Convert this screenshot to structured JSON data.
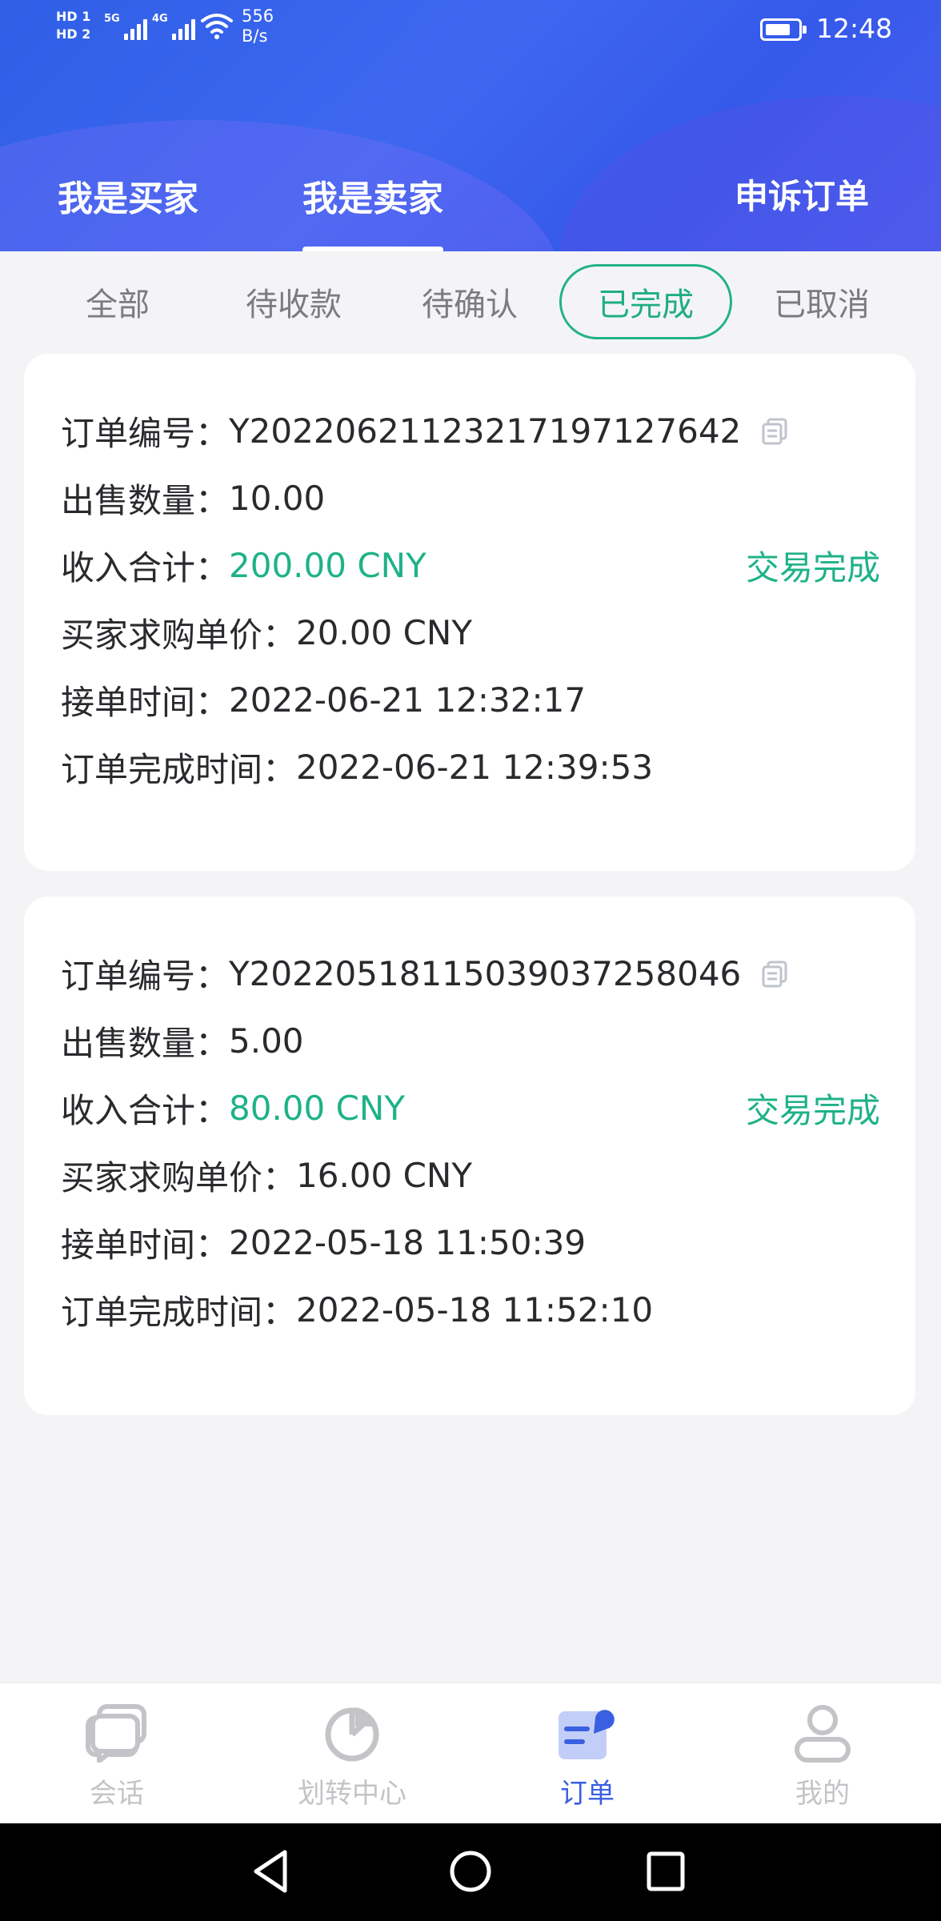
{
  "status_bar": {
    "sim1": "HD 1",
    "sim2": "HD 2",
    "net1": "5G",
    "net2": "4G",
    "speed_value": "556",
    "speed_unit": "B/s",
    "time": "12:48"
  },
  "header": {
    "tabs": [
      {
        "label": "我是买家"
      },
      {
        "label": "我是卖家"
      }
    ],
    "active_tab": 1,
    "appeal_label": "申诉订单"
  },
  "filters": [
    {
      "label": "全部"
    },
    {
      "label": "待收款"
    },
    {
      "label": "待确认"
    },
    {
      "label": "已完成"
    },
    {
      "label": "已取消"
    }
  ],
  "active_filter": 3,
  "orders": [
    {
      "order_no_label": "订单编号：",
      "order_no": "Y20220621123217197127642",
      "qty_label": "出售数量：",
      "qty": "10.00",
      "income_label": "收入合计：",
      "income": "200.00 CNY",
      "status": "交易完成",
      "price_label": "买家求购单价：",
      "price": "20.00 CNY",
      "accept_label": "接单时间：",
      "accept_time": "2022-06-21 12:32:17",
      "complete_label": "订单完成时间：",
      "complete_time": "2022-06-21 12:39:53"
    },
    {
      "order_no_label": "订单编号：",
      "order_no": "Y20220518115039037258046",
      "qty_label": "出售数量：",
      "qty": "5.00",
      "income_label": "收入合计：",
      "income": "80.00 CNY",
      "status": "交易完成",
      "price_label": "买家求购单价：",
      "price": "16.00 CNY",
      "accept_label": "接单时间：",
      "accept_time": "2022-05-18 11:50:39",
      "complete_label": "订单完成时间：",
      "complete_time": "2022-05-18 11:52:10"
    }
  ],
  "bottom_nav": [
    {
      "label": "会话",
      "icon": "chat-icon"
    },
    {
      "label": "划转中心",
      "icon": "pie-chart-icon"
    },
    {
      "label": "订单",
      "icon": "order-icon"
    },
    {
      "label": "我的",
      "icon": "person-icon"
    }
  ],
  "active_nav": 2,
  "colors": {
    "accent_green": "#1fb287",
    "header_blue": "#3e67f0",
    "nav_active": "#3a5fe0"
  }
}
